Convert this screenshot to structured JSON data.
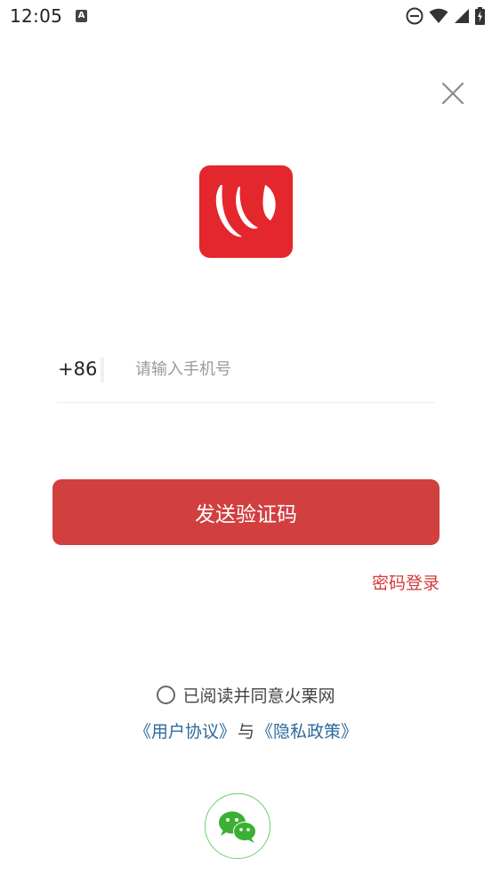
{
  "status_bar": {
    "time": "12:05",
    "notification_icon": "a-box-icon",
    "icons": [
      "do-not-disturb-icon",
      "wifi-icon",
      "signal-icon",
      "battery-icon"
    ]
  },
  "header": {
    "close_icon": "close-icon"
  },
  "logo": {
    "icon": "app-logo-icon",
    "color": "#e4262d"
  },
  "login_form": {
    "country_code": "+86",
    "phone_placeholder": "请输入手机号",
    "phone_value": "",
    "send_code_label": "发送验证码",
    "password_login_label": "密码登录"
  },
  "agreement": {
    "checked": false,
    "text": "已阅读并同意火栗网",
    "user_agreement": "《用户协议》",
    "and_text": "与",
    "privacy_policy": "《隐私政策》"
  },
  "social_login": {
    "wechat_icon": "wechat-icon",
    "color": "#3cb034"
  },
  "colors": {
    "primary_button": "#d13f3f",
    "link_red": "#d43a3a",
    "link_blue": "#2e6a9c"
  }
}
